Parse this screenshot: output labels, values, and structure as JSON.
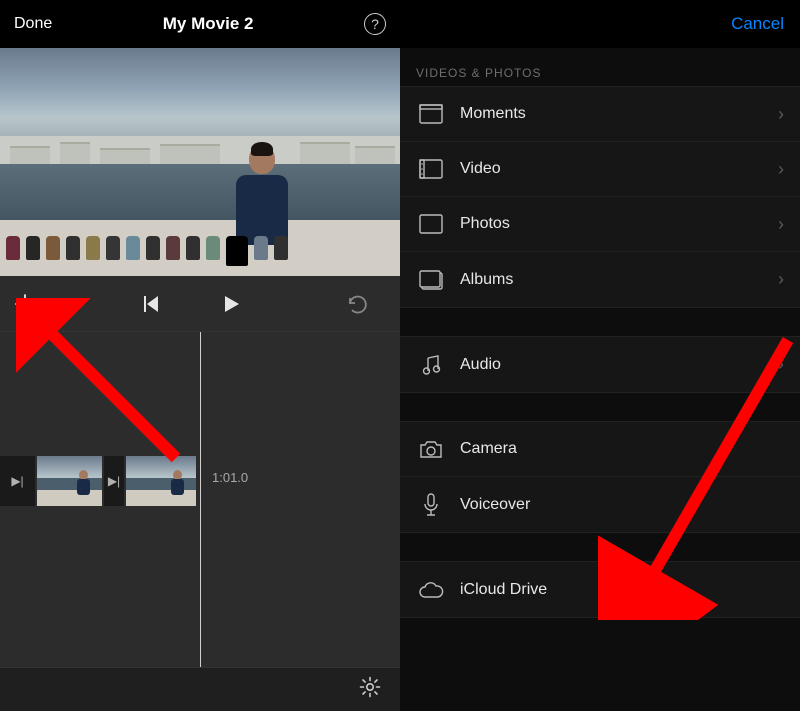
{
  "left": {
    "nav": {
      "done": "Done",
      "title": "My Movie 2",
      "help": "?"
    },
    "timeline": {
      "time_label": "1:01.0"
    }
  },
  "right": {
    "nav": {
      "cancel": "Cancel"
    },
    "section_header": "VIDEOS & PHOTOS",
    "media_items": [
      {
        "label": "Moments",
        "icon": "moments",
        "chevron": true
      },
      {
        "label": "Video",
        "icon": "video",
        "chevron": true
      },
      {
        "label": "Photos",
        "icon": "photos",
        "chevron": true
      },
      {
        "label": "Albums",
        "icon": "albums",
        "chevron": true
      }
    ],
    "audio_items": [
      {
        "label": "Audio",
        "icon": "audio",
        "chevron": true
      }
    ],
    "capture_items": [
      {
        "label": "Camera",
        "icon": "camera",
        "chevron": false
      },
      {
        "label": "Voiceover",
        "icon": "voiceover",
        "chevron": false
      }
    ],
    "cloud_items": [
      {
        "label": "iCloud Drive",
        "icon": "icloud",
        "chevron": false
      }
    ]
  }
}
